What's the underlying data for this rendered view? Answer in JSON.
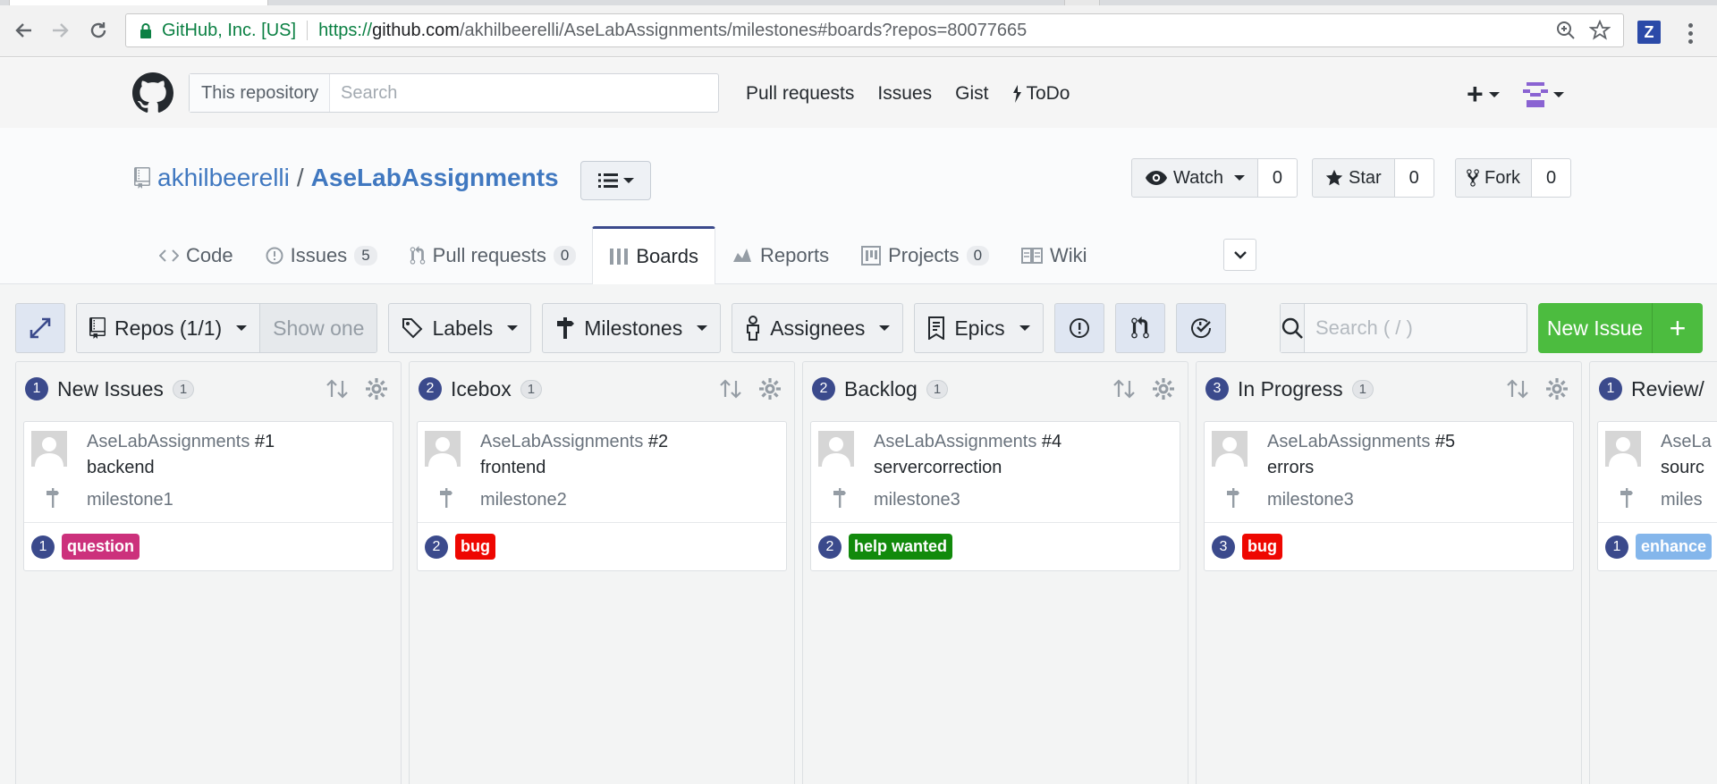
{
  "browser": {
    "secure_label": "GitHub, Inc. [US]",
    "url_proto": "https://",
    "url_host": "github.com",
    "url_path": "/akhilbeerelli/AseLabAssignments/milestones#boards?repos=80077665",
    "extension_label": "Z"
  },
  "header": {
    "search_scope": "This repository",
    "search_placeholder": "Search",
    "nav": [
      "Pull requests",
      "Issues",
      "Gist",
      "ToDo"
    ],
    "plus_label": "+"
  },
  "repo": {
    "owner": "akhilbeerelli",
    "slash": "/",
    "name": "AseLabAssignments",
    "watch": {
      "label": "Watch",
      "count": "0"
    },
    "star": {
      "label": "Star",
      "count": "0"
    },
    "fork": {
      "label": "Fork",
      "count": "0"
    },
    "tabs": [
      {
        "label": "Code",
        "count": null,
        "icon": "code-icon"
      },
      {
        "label": "Issues",
        "count": "5",
        "icon": "issue-opened-icon"
      },
      {
        "label": "Pull requests",
        "count": "0",
        "icon": "git-pull-request-icon"
      },
      {
        "label": "Boards",
        "count": null,
        "icon": "boards-icon",
        "selected": true
      },
      {
        "label": "Reports",
        "count": null,
        "icon": "graph-icon"
      },
      {
        "label": "Projects",
        "count": "0",
        "icon": "project-icon"
      },
      {
        "label": "Wiki",
        "count": null,
        "icon": "book-icon"
      }
    ]
  },
  "toolbar": {
    "repos_label": "Repos (1/1)",
    "show_one_label": "Show one",
    "labels_label": "Labels",
    "milestones_label": "Milestones",
    "assignees_label": "Assignees",
    "epics_label": "Epics",
    "search_placeholder": "Search ( / )",
    "new_issue_label": "New Issue",
    "new_issue_plus": "+"
  },
  "columns": [
    {
      "num": "1",
      "title": "New Issues",
      "count": "1",
      "card": {
        "repo": "AseLabAssignments",
        "issue": "#1",
        "title": "backend",
        "milestone": "milestone1",
        "footer_num": "1",
        "label": "question",
        "label_color": "#cc317c"
      }
    },
    {
      "num": "2",
      "title": "Icebox",
      "count": "1",
      "card": {
        "repo": "AseLabAssignments",
        "issue": "#2",
        "title": "frontend",
        "milestone": "milestone2",
        "footer_num": "2",
        "label": "bug",
        "label_color": "#ee0701"
      }
    },
    {
      "num": "2",
      "title": "Backlog",
      "count": "1",
      "card": {
        "repo": "AseLabAssignments",
        "issue": "#4",
        "title": "servercorrection",
        "milestone": "milestone3",
        "footer_num": "2",
        "label": "help wanted",
        "label_color": "#128a0c"
      }
    },
    {
      "num": "3",
      "title": "In Progress",
      "count": "1",
      "card": {
        "repo": "AseLabAssignments",
        "issue": "#5",
        "title": "errors",
        "milestone": "milestone3",
        "footer_num": "3",
        "label": "bug",
        "label_color": "#ee0701"
      }
    },
    {
      "num": "1",
      "title": "Review/",
      "count": "",
      "card": {
        "repo": "AseLa",
        "issue": "",
        "title": "sourc",
        "milestone": "miles",
        "footer_num": "1",
        "label": "enhance",
        "label_color": "#84b6eb"
      }
    }
  ]
}
